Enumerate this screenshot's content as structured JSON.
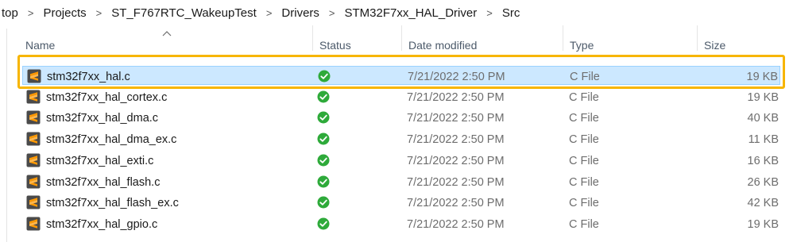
{
  "breadcrumb": [
    "top",
    "Projects",
    "ST_F767RTC_WakeupTest",
    "Drivers",
    "STM32F7xx_HAL_Driver",
    "Src"
  ],
  "columns": {
    "name": "Name",
    "status": "Status",
    "date": "Date modified",
    "type": "Type",
    "size": "Size"
  },
  "files": [
    {
      "name": "stm32f7xx_hal.c",
      "date": "7/21/2022 2:50 PM",
      "type": "C File",
      "size": "19 KB",
      "selected": true
    },
    {
      "name": "stm32f7xx_hal_cortex.c",
      "date": "7/21/2022 2:50 PM",
      "type": "C File",
      "size": "19 KB"
    },
    {
      "name": "stm32f7xx_hal_dma.c",
      "date": "7/21/2022 2:50 PM",
      "type": "C File",
      "size": "40 KB"
    },
    {
      "name": "stm32f7xx_hal_dma_ex.c",
      "date": "7/21/2022 2:50 PM",
      "type": "C File",
      "size": "11 KB"
    },
    {
      "name": "stm32f7xx_hal_exti.c",
      "date": "7/21/2022 2:50 PM",
      "type": "C File",
      "size": "16 KB"
    },
    {
      "name": "stm32f7xx_hal_flash.c",
      "date": "7/21/2022 2:50 PM",
      "type": "C File",
      "size": "26 KB"
    },
    {
      "name": "stm32f7xx_hal_flash_ex.c",
      "date": "7/21/2022 2:50 PM",
      "type": "C File",
      "size": "42 KB"
    },
    {
      "name": "stm32f7xx_hal_gpio.c",
      "date": "7/21/2022 2:50 PM",
      "type": "C File",
      "size": "19 KB"
    }
  ],
  "icons": {
    "file": "sublime-text-file-icon",
    "status": "synced-check-icon",
    "sort": "sort-ascending-icon"
  },
  "colors": {
    "selection": "#cce8ff",
    "highlight_border": "#f7b500",
    "status_green": "#2eaa3a",
    "file_icon_orange": "#ff9800"
  }
}
